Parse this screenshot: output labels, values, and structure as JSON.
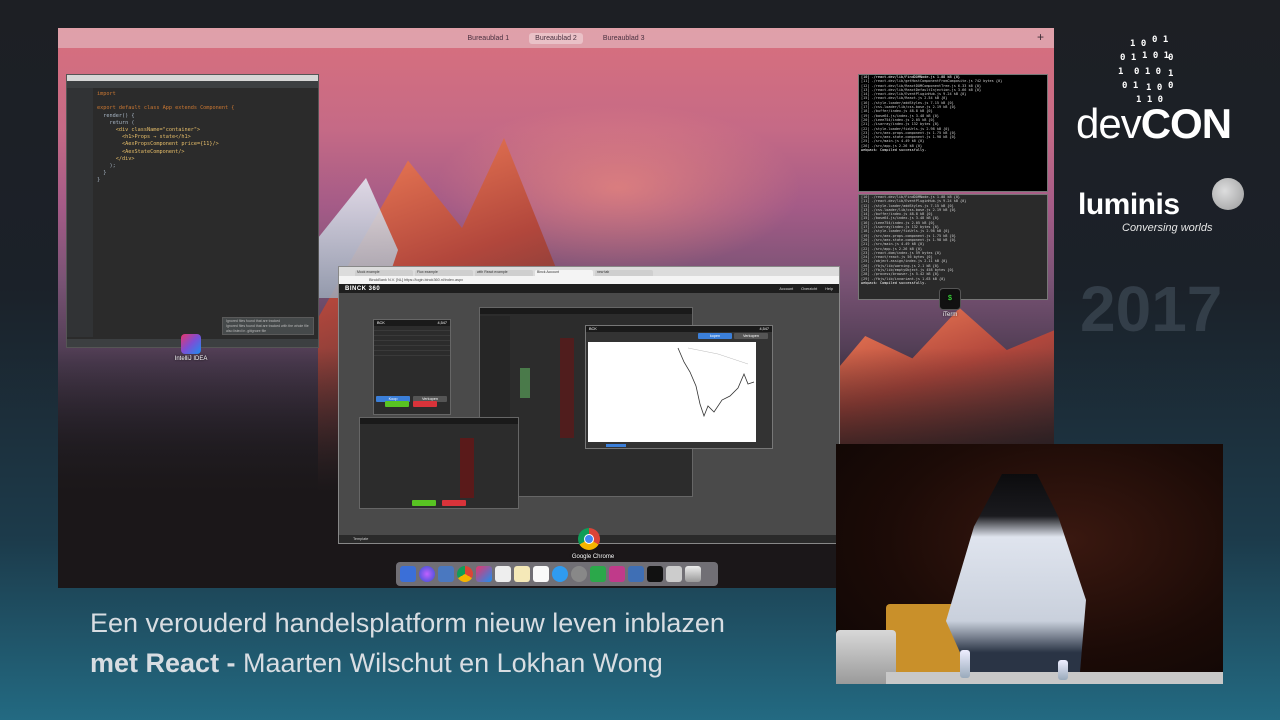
{
  "menubar": {
    "spaces": [
      "Bureaublad 1",
      "Bureaublad 2",
      "Bureaublad 3"
    ],
    "active_space": "Bureaublad 2",
    "add_label": "+"
  },
  "ide": {
    "code_lines": [
      "import",
      "",
      "export default class App extends Component {",
      "  render() {",
      "    return (",
      "      <div className=\"container\">",
      "        <h1>Props → state</h1>",
      "        <AexPropsComponent price={11}/>",
      "        <AexStateComponent/>",
      "      </div>",
      "    );",
      "  }",
      "}"
    ],
    "notification_title": "Ignored files found that are tracked",
    "notification_body": "Ignored files found that are tracked with the whole file also listed in .gitignore file"
  },
  "desktop_icons": {
    "intellij": "IntelliJ IDEA",
    "iterm": "iTerm",
    "chrome": "Google Chrome"
  },
  "browser": {
    "tabs": [
      "Mock example",
      "Flux example",
      "with React example",
      "Binck Account",
      "new tab"
    ],
    "url": "BinckBank N.V. [NL] https://login.binck360.nl/index.aspx",
    "brand": "BINCK 360",
    "nav_links": [
      "Account",
      "Overzicht",
      "Help"
    ],
    "order_panel": {
      "title": "BCK",
      "price": "4,547",
      "buy_label": "Koop",
      "sell_label": "Verkopen"
    },
    "chart_panel": {
      "title": "BCK",
      "price": "4,547",
      "buy_label": "kopen",
      "sell_label": "Verkopen"
    },
    "taskbar_label": "Template"
  },
  "branding": {
    "event_name_light": "dev",
    "event_name_bold": "CON",
    "company": "luminis",
    "tagline": "Conversing worlds",
    "year": "2017"
  },
  "caption": {
    "line1": "Een verouderd handelsplatform nieuw leven inblazen",
    "line2_bold": "met React -",
    "line2_rest": " Maarten Wilschut en Lokhan Wong"
  },
  "colors": {
    "accent_blue": "#3b7fd9",
    "buy_green": "#58c322",
    "sell_red": "#d9333a"
  }
}
